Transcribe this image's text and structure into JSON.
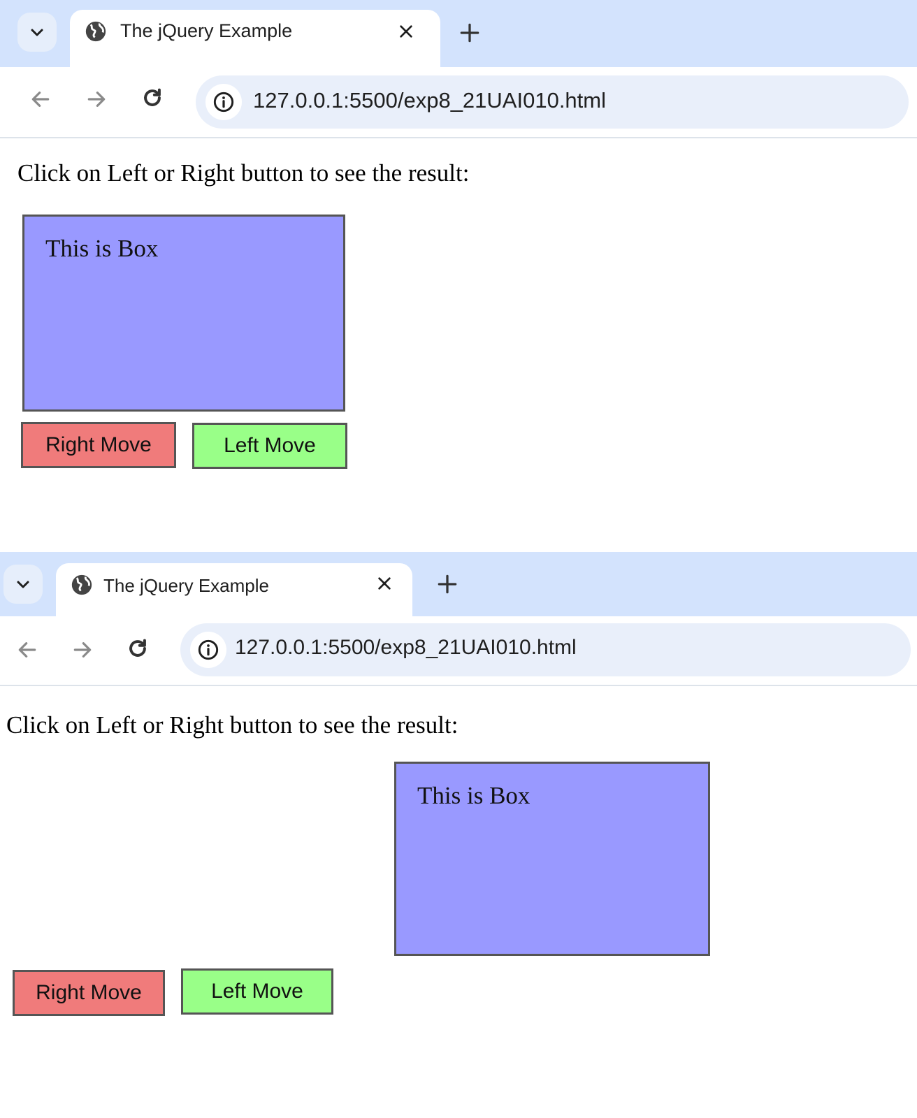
{
  "browser": {
    "tab_title": "The jQuery Example",
    "url": "127.0.0.1:5500/exp8_21UAI010.html",
    "icons": {
      "tab_search": "chevron-down-icon",
      "favicon": "globe-icon",
      "close": "close-icon",
      "new_tab": "plus-icon",
      "back": "arrow-left-icon",
      "forward": "arrow-right-icon",
      "reload": "reload-icon",
      "site_info": "info-icon"
    }
  },
  "page": {
    "instruction": "Click on Left or Right button to see the result:",
    "box_text": "This is Box",
    "right_button": "Right Move",
    "left_button": "Left Move"
  },
  "colors": {
    "box": "#9999ff",
    "right_button": "#f07b7b",
    "left_button": "#99ff88",
    "tabstrip": "#d3e3fd"
  },
  "screenshots": [
    {
      "state": "initial"
    },
    {
      "state": "after-right-move"
    }
  ]
}
